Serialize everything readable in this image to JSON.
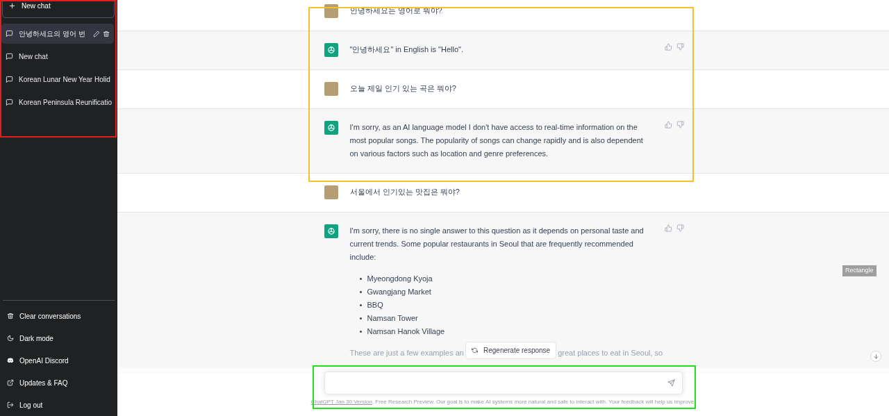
{
  "sidebar": {
    "new_chat_button": "New chat",
    "conversations": [
      {
        "title": "안녕하세요의 영어 번",
        "selected": true
      },
      {
        "title": "New chat",
        "selected": false
      },
      {
        "title": "Korean Lunar New Year Holid",
        "selected": false
      },
      {
        "title": "Korean Peninsula Reunificatio",
        "selected": false
      }
    ],
    "menu": [
      {
        "label": "Clear conversations",
        "kind": "trash"
      },
      {
        "label": "Dark mode",
        "kind": "moon"
      },
      {
        "label": "OpenAI Discord",
        "kind": "discord"
      },
      {
        "label": "Updates & FAQ",
        "kind": "external"
      },
      {
        "label": "Log out",
        "kind": "logout"
      }
    ]
  },
  "messages": [
    {
      "kind": "user",
      "text": "안녕하세요는 영어로 뭐야?"
    },
    {
      "kind": "assistant",
      "paragraphs": [
        "\"안녕하세요\" in English is \"Hello\"."
      ]
    },
    {
      "kind": "user",
      "text": "오늘 제일 인기 있는 곡은 뭐야?"
    },
    {
      "kind": "assistant",
      "paragraphs": [
        "I'm sorry, as an AI language model I don't have access to real-time information on the most popular songs. The popularity of songs can change rapidly and is also dependent on various factors such as location and genre preferences."
      ]
    },
    {
      "kind": "user",
      "text": "서울에서 인기있는 맛집은 뭐야?"
    },
    {
      "kind": "assistant",
      "paragraphs": [
        "I'm sorry, there is no single answer to this question as it depends on personal taste and current trends. Some popular restaurants in Seoul that are frequently recommended include:"
      ],
      "bullets": [
        "Myeongdong Kyoja",
        "Gwangjang Market",
        "BBQ",
        "Namsan Tower",
        "Namsan Hanok Village"
      ],
      "cut_line": [
        "These are just a few examples an",
        "great places to eat in Seoul, so"
      ]
    }
  ],
  "regenerate_button": "Regenerate response",
  "tooltip": "Rectangle",
  "footer": {
    "link": "ChatGPT Jan 30 Version",
    "text": ". Free Research Preview. Our goal is to make AI systems more natural and safe to interact with. Your feedback will help us improve."
  },
  "annotations": [
    {
      "color": "#e81c1c"
    },
    {
      "color": "#f5c02a"
    },
    {
      "color": "#22e01c"
    }
  ]
}
